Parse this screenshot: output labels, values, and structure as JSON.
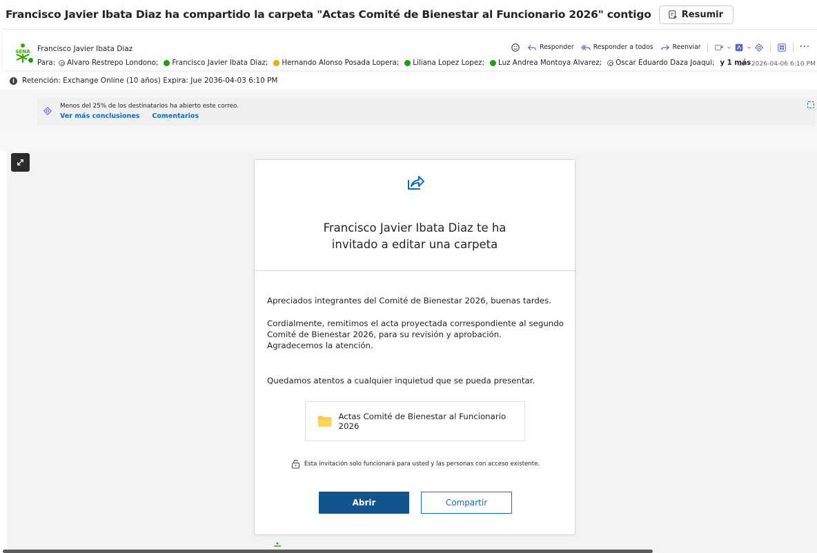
{
  "subject": {
    "title": "Francisco Javier Ibata Diaz ha compartido la carpeta \"Actas Comité de Bienestar al Funcionario 2026\" contigo",
    "summarize_label": "Resumir"
  },
  "header": {
    "sender_name": "Francisco Javier Ibata Diaz",
    "to_label": "Para:",
    "recipients": [
      {
        "name": "Alvaro Restrepo Londono;",
        "status": "offline"
      },
      {
        "name": "Francisco Javier Ibata Diaz;",
        "status": "available"
      },
      {
        "name": "Hernando Alonso Posada Lopera;",
        "status": "away"
      },
      {
        "name": "Liliana Lopez Lopez;",
        "status": "available"
      },
      {
        "name": "Luz Andrea Montoya Alvarez;",
        "status": "available"
      },
      {
        "name": "Oscar Eduardo Daza Joaqui;",
        "status": "offline"
      }
    ],
    "more_label": "y 1 más",
    "timestamp": "Lun 2026-04-06 6:10 PM",
    "actions": {
      "reply": "Responder",
      "reply_all": "Responder a todos",
      "forward": "Reenviar"
    }
  },
  "retention": {
    "text": "Retención: Exchange Online (10 años) Expira: Jue 2036-04-03 6:10 PM"
  },
  "insights": {
    "text": "Menos del 25% de los destinatarios ha abierto este correo.",
    "link_more": "Ver más conclusiones",
    "link_comments": "Comentarios"
  },
  "card": {
    "title_line1": "Francisco Javier Ibata Diaz te ha",
    "title_line2": "invitado a editar una carpeta",
    "para1": "Apreciados integrantes del Comité de Bienestar 2026, buenas tardes.",
    "para2_line1": "Cordialmente, remitimos el acta proyectada correspondiente al segundo Comité de Bienestar 2026, para su revisión y aprobación.",
    "para2_line2": "Agradecemos la atención.",
    "para3": "Quedamos atentos a cualquier inquietud que se pueda presentar.",
    "folder_name": "Actas Comité de Bienestar al Funcionario 2026",
    "lock_note": "Esta invitación solo funcionará para usted y las personas con acceso existente.",
    "open_label": "Abrir",
    "share_label": "Compartir"
  },
  "colors": {
    "accent": "#0f6cbd",
    "primary_button": "#0f548c",
    "available": "#13a10e",
    "away": "#f7a800",
    "folder": "#ffc83d"
  }
}
